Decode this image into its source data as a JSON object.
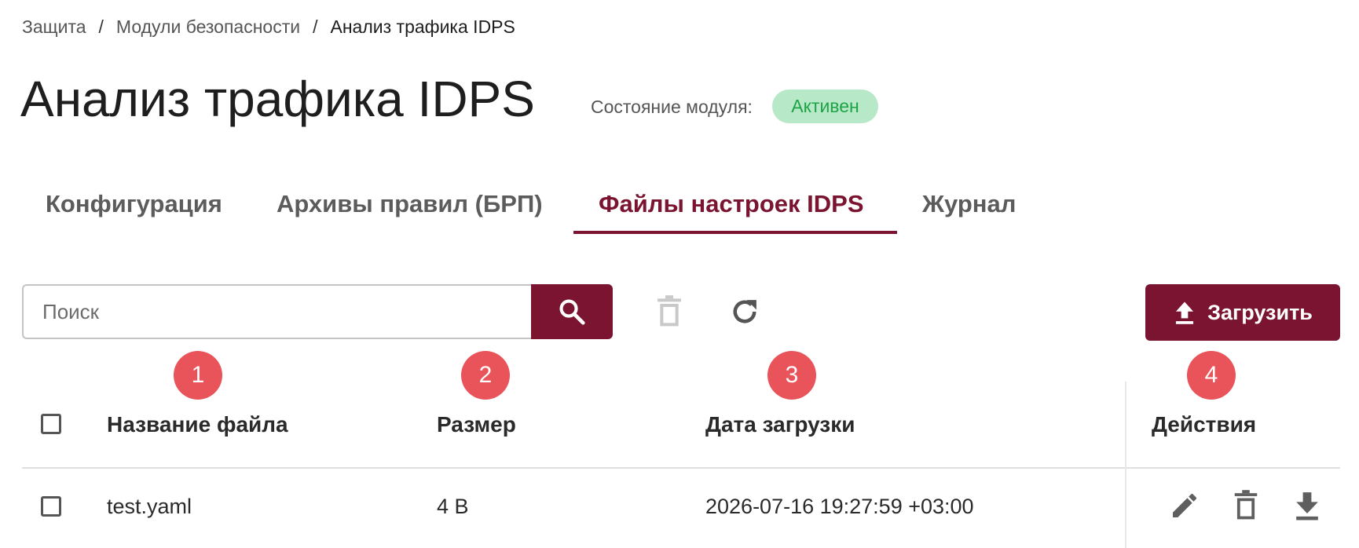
{
  "breadcrumb": {
    "items": [
      "Защита",
      "Модули безопасности",
      "Анализ трафика IDPS"
    ],
    "separator": "/"
  },
  "page": {
    "title": "Анализ трафика IDPS",
    "status_label": "Состояние модуля:",
    "status_value": "Активен"
  },
  "tabs": [
    {
      "label": "Конфигурация",
      "active": false
    },
    {
      "label": "Архивы правил (БРП)",
      "active": false
    },
    {
      "label": "Файлы настроек IDPS",
      "active": true
    },
    {
      "label": "Журнал",
      "active": false
    }
  ],
  "toolbar": {
    "search_placeholder": "Поиск",
    "search_icon": "search-icon",
    "delete_icon": "trash-icon",
    "refresh_icon": "refresh-icon",
    "upload_label": "Загрузить",
    "upload_icon": "upload-icon"
  },
  "markers": [
    "1",
    "2",
    "3",
    "4"
  ],
  "table": {
    "columns": [
      "Название файла",
      "Размер",
      "Дата загрузки",
      "Действия"
    ],
    "rows": [
      {
        "name": "test.yaml",
        "size": "4 B",
        "uploaded": "2026-07-16 19:27:59 +03:00",
        "actions": [
          "pencil-icon",
          "trash-icon",
          "download-icon"
        ]
      }
    ]
  },
  "colors": {
    "accent": "#7a1430",
    "status_bg": "#b7e8c7",
    "status_text": "#1fa347",
    "marker": "#e8545a"
  }
}
